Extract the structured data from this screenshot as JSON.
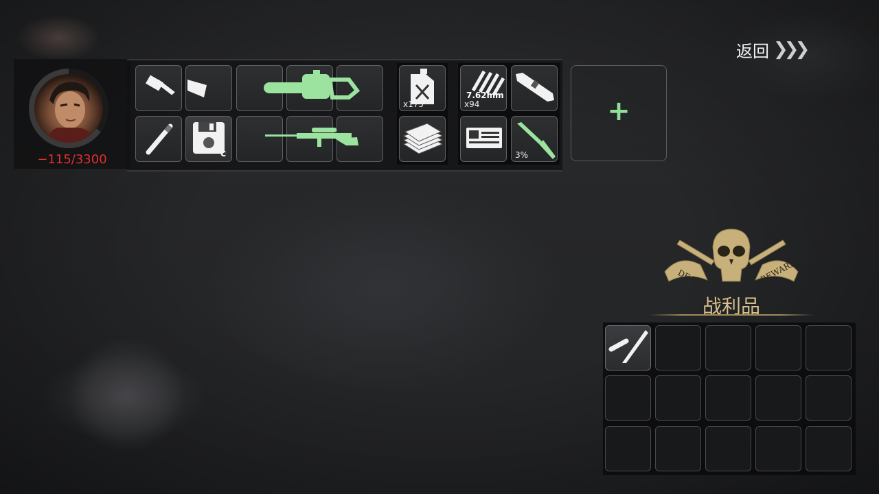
{
  "header": {
    "back_label": "返回"
  },
  "player": {
    "hp_text": "−115/3300"
  },
  "equipment": {
    "fuel_count": "x175",
    "ammo_label": "7.62mm",
    "ammo_count": "x94",
    "knife_durability": "3%"
  },
  "loot": {
    "title": "战利品",
    "emblem_left_text": "DEAD",
    "emblem_right_text": "REWARD"
  },
  "colors": {
    "accent_green": "#8fdf95",
    "hp_red": "#e0302a",
    "loot_gold": "#d7c08c"
  }
}
